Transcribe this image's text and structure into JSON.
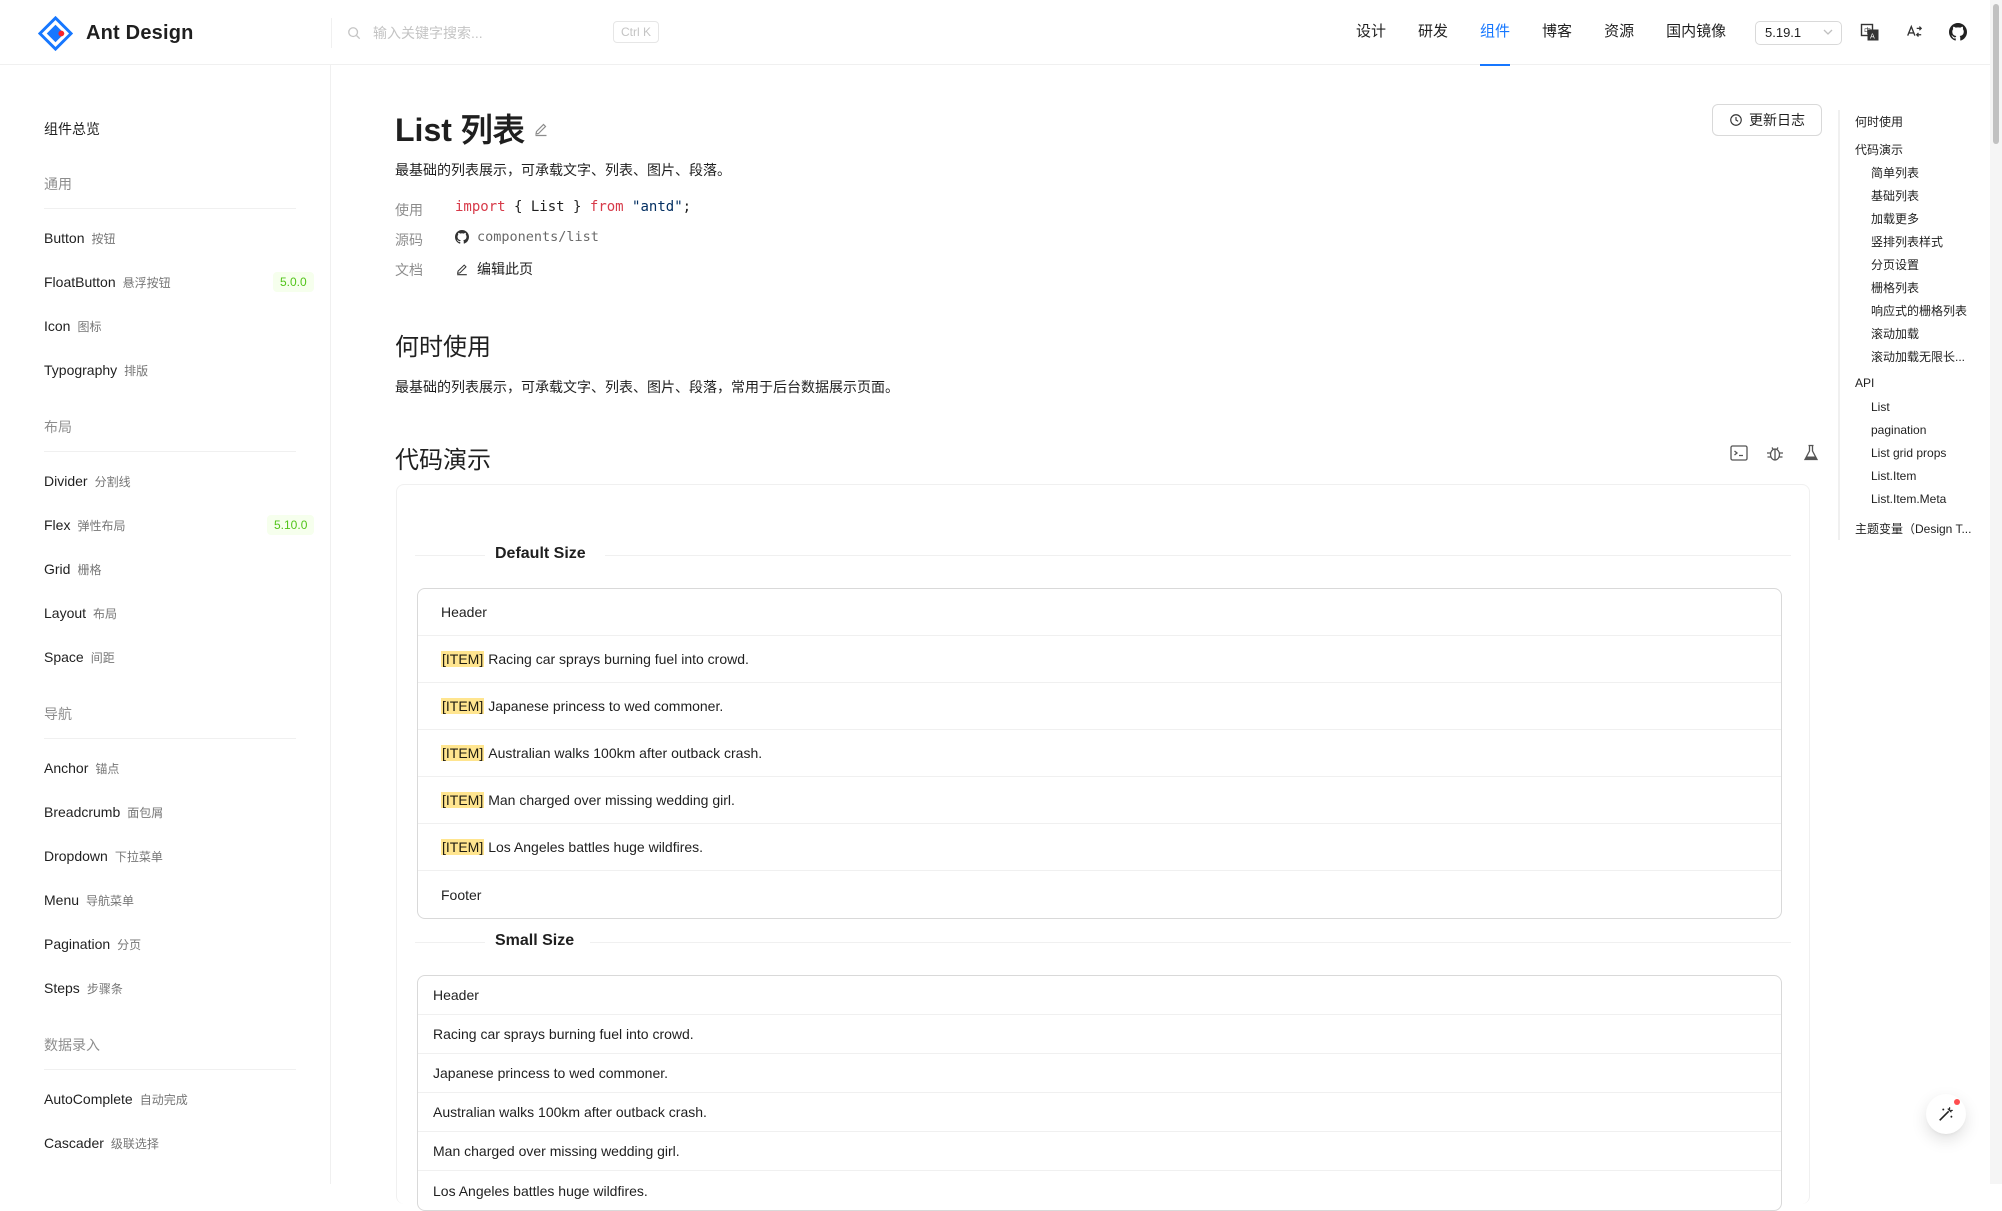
{
  "header": {
    "logo_text": "Ant Design",
    "search_placeholder": "输入关键字搜索...",
    "search_shortcut": "Ctrl K",
    "nav": [
      "设计",
      "研发",
      "组件",
      "博客",
      "资源",
      "国内镜像"
    ],
    "active_nav": "组件",
    "version": "5.19.1"
  },
  "sidebar": {
    "overview": "组件总览",
    "groups": {
      "general": "通用",
      "layout": "布局",
      "navigation": "导航",
      "data_entry": "数据录入"
    },
    "items": {
      "button": {
        "en": "Button",
        "cn": "按钮"
      },
      "floatbutton": {
        "en": "FloatButton",
        "cn": "悬浮按钮",
        "badge": "5.0.0"
      },
      "icon": {
        "en": "Icon",
        "cn": "图标"
      },
      "typography": {
        "en": "Typography",
        "cn": "排版"
      },
      "divider": {
        "en": "Divider",
        "cn": "分割线"
      },
      "flex": {
        "en": "Flex",
        "cn": "弹性布局",
        "badge": "5.10.0"
      },
      "grid": {
        "en": "Grid",
        "cn": "栅格"
      },
      "layout": {
        "en": "Layout",
        "cn": "布局"
      },
      "space": {
        "en": "Space",
        "cn": "间距"
      },
      "anchor": {
        "en": "Anchor",
        "cn": "锚点"
      },
      "breadcrumb": {
        "en": "Breadcrumb",
        "cn": "面包屑"
      },
      "dropdown": {
        "en": "Dropdown",
        "cn": "下拉菜单"
      },
      "menu": {
        "en": "Menu",
        "cn": "导航菜单"
      },
      "pagination": {
        "en": "Pagination",
        "cn": "分页"
      },
      "steps": {
        "en": "Steps",
        "cn": "步骤条"
      },
      "autocomplete": {
        "en": "AutoComplete",
        "cn": "自动完成"
      },
      "cascader": {
        "en": "Cascader",
        "cn": "级联选择"
      }
    }
  },
  "main": {
    "title": "List 列表",
    "changelog": "更新日志",
    "description": "最基础的列表展示，可承载文字、列表、图片、段落。",
    "meta": {
      "usage_label": "使用",
      "usage_import": "import",
      "usage_braces_open": "{ List }",
      "usage_from": "from",
      "usage_pkg": "\"antd\"",
      "usage_semi": ";",
      "source_label": "源码",
      "source_value": "components/list",
      "docs_label": "文档",
      "docs_value": "编辑此页"
    },
    "when_title": "何时使用",
    "when_text": "最基础的列表展示，可承载文字、列表、图片、段落，常用于后台数据展示页面。",
    "demo_title": "代码演示",
    "demo": {
      "default_title": "Default Size",
      "small_title": "Small Size",
      "header": "Header",
      "footer": "Footer",
      "tag": "[ITEM]",
      "items": [
        "Racing car sprays burning fuel into crowd.",
        "Japanese princess to wed commoner.",
        "Australian walks 100km after outback crash.",
        "Man charged over missing wedding girl.",
        "Los Angeles battles huge wildfires."
      ]
    }
  },
  "anchor": {
    "items": [
      "何时使用",
      "代码演示",
      "简单列表",
      "基础列表",
      "加载更多",
      "竖排列表样式",
      "分页设置",
      "栅格列表",
      "响应式的栅格列表",
      "滚动加载",
      "滚动加载无限长...",
      "API",
      "List",
      "pagination",
      "List grid props",
      "List.Item",
      "List.Item.Meta",
      "主题变量（Design T..."
    ]
  },
  "colors": {
    "primary": "#1677ff",
    "badge_green": "#52c41a",
    "highlight": "#ffe58f"
  }
}
